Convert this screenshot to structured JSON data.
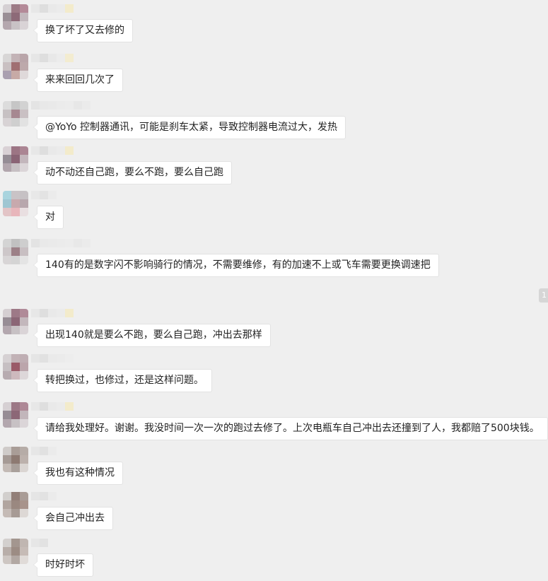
{
  "messages": [
    {
      "text": "换了坏了又去修的"
    },
    {
      "text": "来来回回几次了"
    },
    {
      "text": "@YoYo 控制器通讯，可能是刹车太紧，导致控制器电流过大，发热"
    },
    {
      "text": "动不动还自己跑，要么不跑，要么自己跑"
    },
    {
      "text": "对"
    },
    {
      "text": "140有的是数字闪不影响骑行的情况，不需要维修，有的加速不上或飞车需要更换调速把"
    },
    {
      "text": "出现140就是要么不跑，要么自己跑，冲出去那样"
    },
    {
      "text": "转把换过，也修过，还是这样问题。"
    },
    {
      "text": "请给我处理好。谢谢。我没时间一次一次的跑过去修了。上次电瓶车自己冲出去还撞到了人，我都赔了500块钱。"
    },
    {
      "text": "我也有这种情况"
    },
    {
      "text": "会自己冲出去"
    },
    {
      "text": "时好时坏"
    }
  ],
  "side_badge": "1",
  "colors": {
    "background": "#efefef",
    "bubble": "#ffffff",
    "bubble_border": "#e2e2e2"
  }
}
